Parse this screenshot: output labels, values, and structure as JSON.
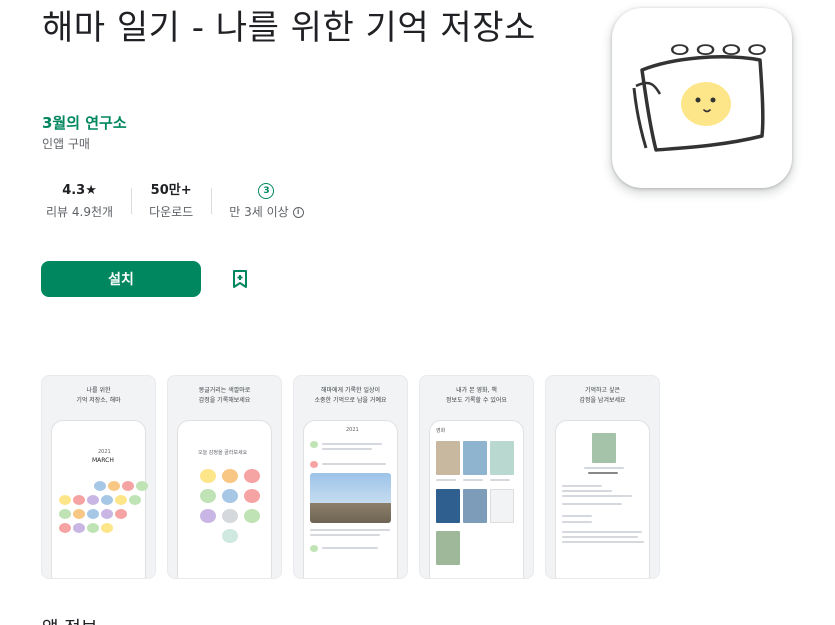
{
  "app": {
    "title": "해마 일기 - 나를 위한 기억 저장소",
    "developer": "3월의 연구소",
    "iap": "인앱 구매"
  },
  "stats": {
    "rating": "4.3★",
    "reviews": "리뷰 4.9천개",
    "downloads": "50만+",
    "downloads_label": "다운로드",
    "age_badge": "3",
    "age_label": "만 3세 이상",
    "info_glyph": "i"
  },
  "actions": {
    "install": "설치",
    "wishlist_icon": "bookmark-add-icon"
  },
  "icon_art": {
    "scribble": "ᄋᄋᄋᄋ"
  },
  "screenshots": [
    {
      "caption_line1": "나를 위한",
      "caption_line2": "기억 저장소, 해마",
      "month_year": "2021",
      "month": "MARCH"
    },
    {
      "caption_line1": "몽글거리는 색깔마로",
      "caption_line2": "감정을 기록해보세요",
      "prompt": "오늘 감정을 골라보세요"
    },
    {
      "caption_line1": "해마에게 기록한 일상이",
      "caption_line2": "소중한 기억으로 남을 거예요",
      "header": "2021"
    },
    {
      "caption_line1": "내가 본 영화, 책",
      "caption_line2": "정보도 기록할 수 있어요",
      "header": "영화"
    },
    {
      "caption_line1": "기억하고 싶은",
      "caption_line2": "감정을 남겨보세요",
      "header": ""
    }
  ],
  "section": {
    "heading": "앱 정보"
  },
  "colors": {
    "accent": "#01875f",
    "text_primary": "#202124",
    "text_secondary": "#5f6368",
    "icon_face": "#fde68a"
  }
}
